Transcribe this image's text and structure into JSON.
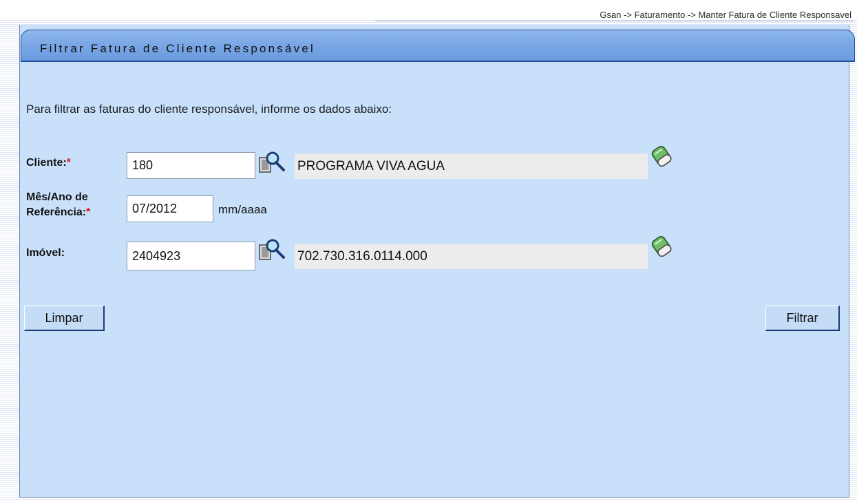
{
  "breadcrumb": "Gsan -> Faturamento -> Manter Fatura de Cliente Responsavel",
  "title": "Filtrar Fatura de Cliente Responsável",
  "instruction": "Para filtrar as faturas do cliente responsável, informe os dados abaixo:",
  "fields": {
    "cliente": {
      "label": "Cliente:",
      "required_mark": "*",
      "value": "180",
      "description": "PROGRAMA VIVA AGUA"
    },
    "mes_ano": {
      "label_line1": "Mês/Ano de",
      "label_line2": "Referência:",
      "required_mark": "*",
      "value": "07/2012",
      "hint": "mm/aaaa"
    },
    "imovel": {
      "label": "Imóvel:",
      "value": "2404923",
      "description": "702.730.316.0114.000"
    }
  },
  "buttons": {
    "clear": "Limpar",
    "filter": "Filtrar"
  },
  "icons": {
    "search": "search-icon",
    "erase": "eraser-icon"
  }
}
